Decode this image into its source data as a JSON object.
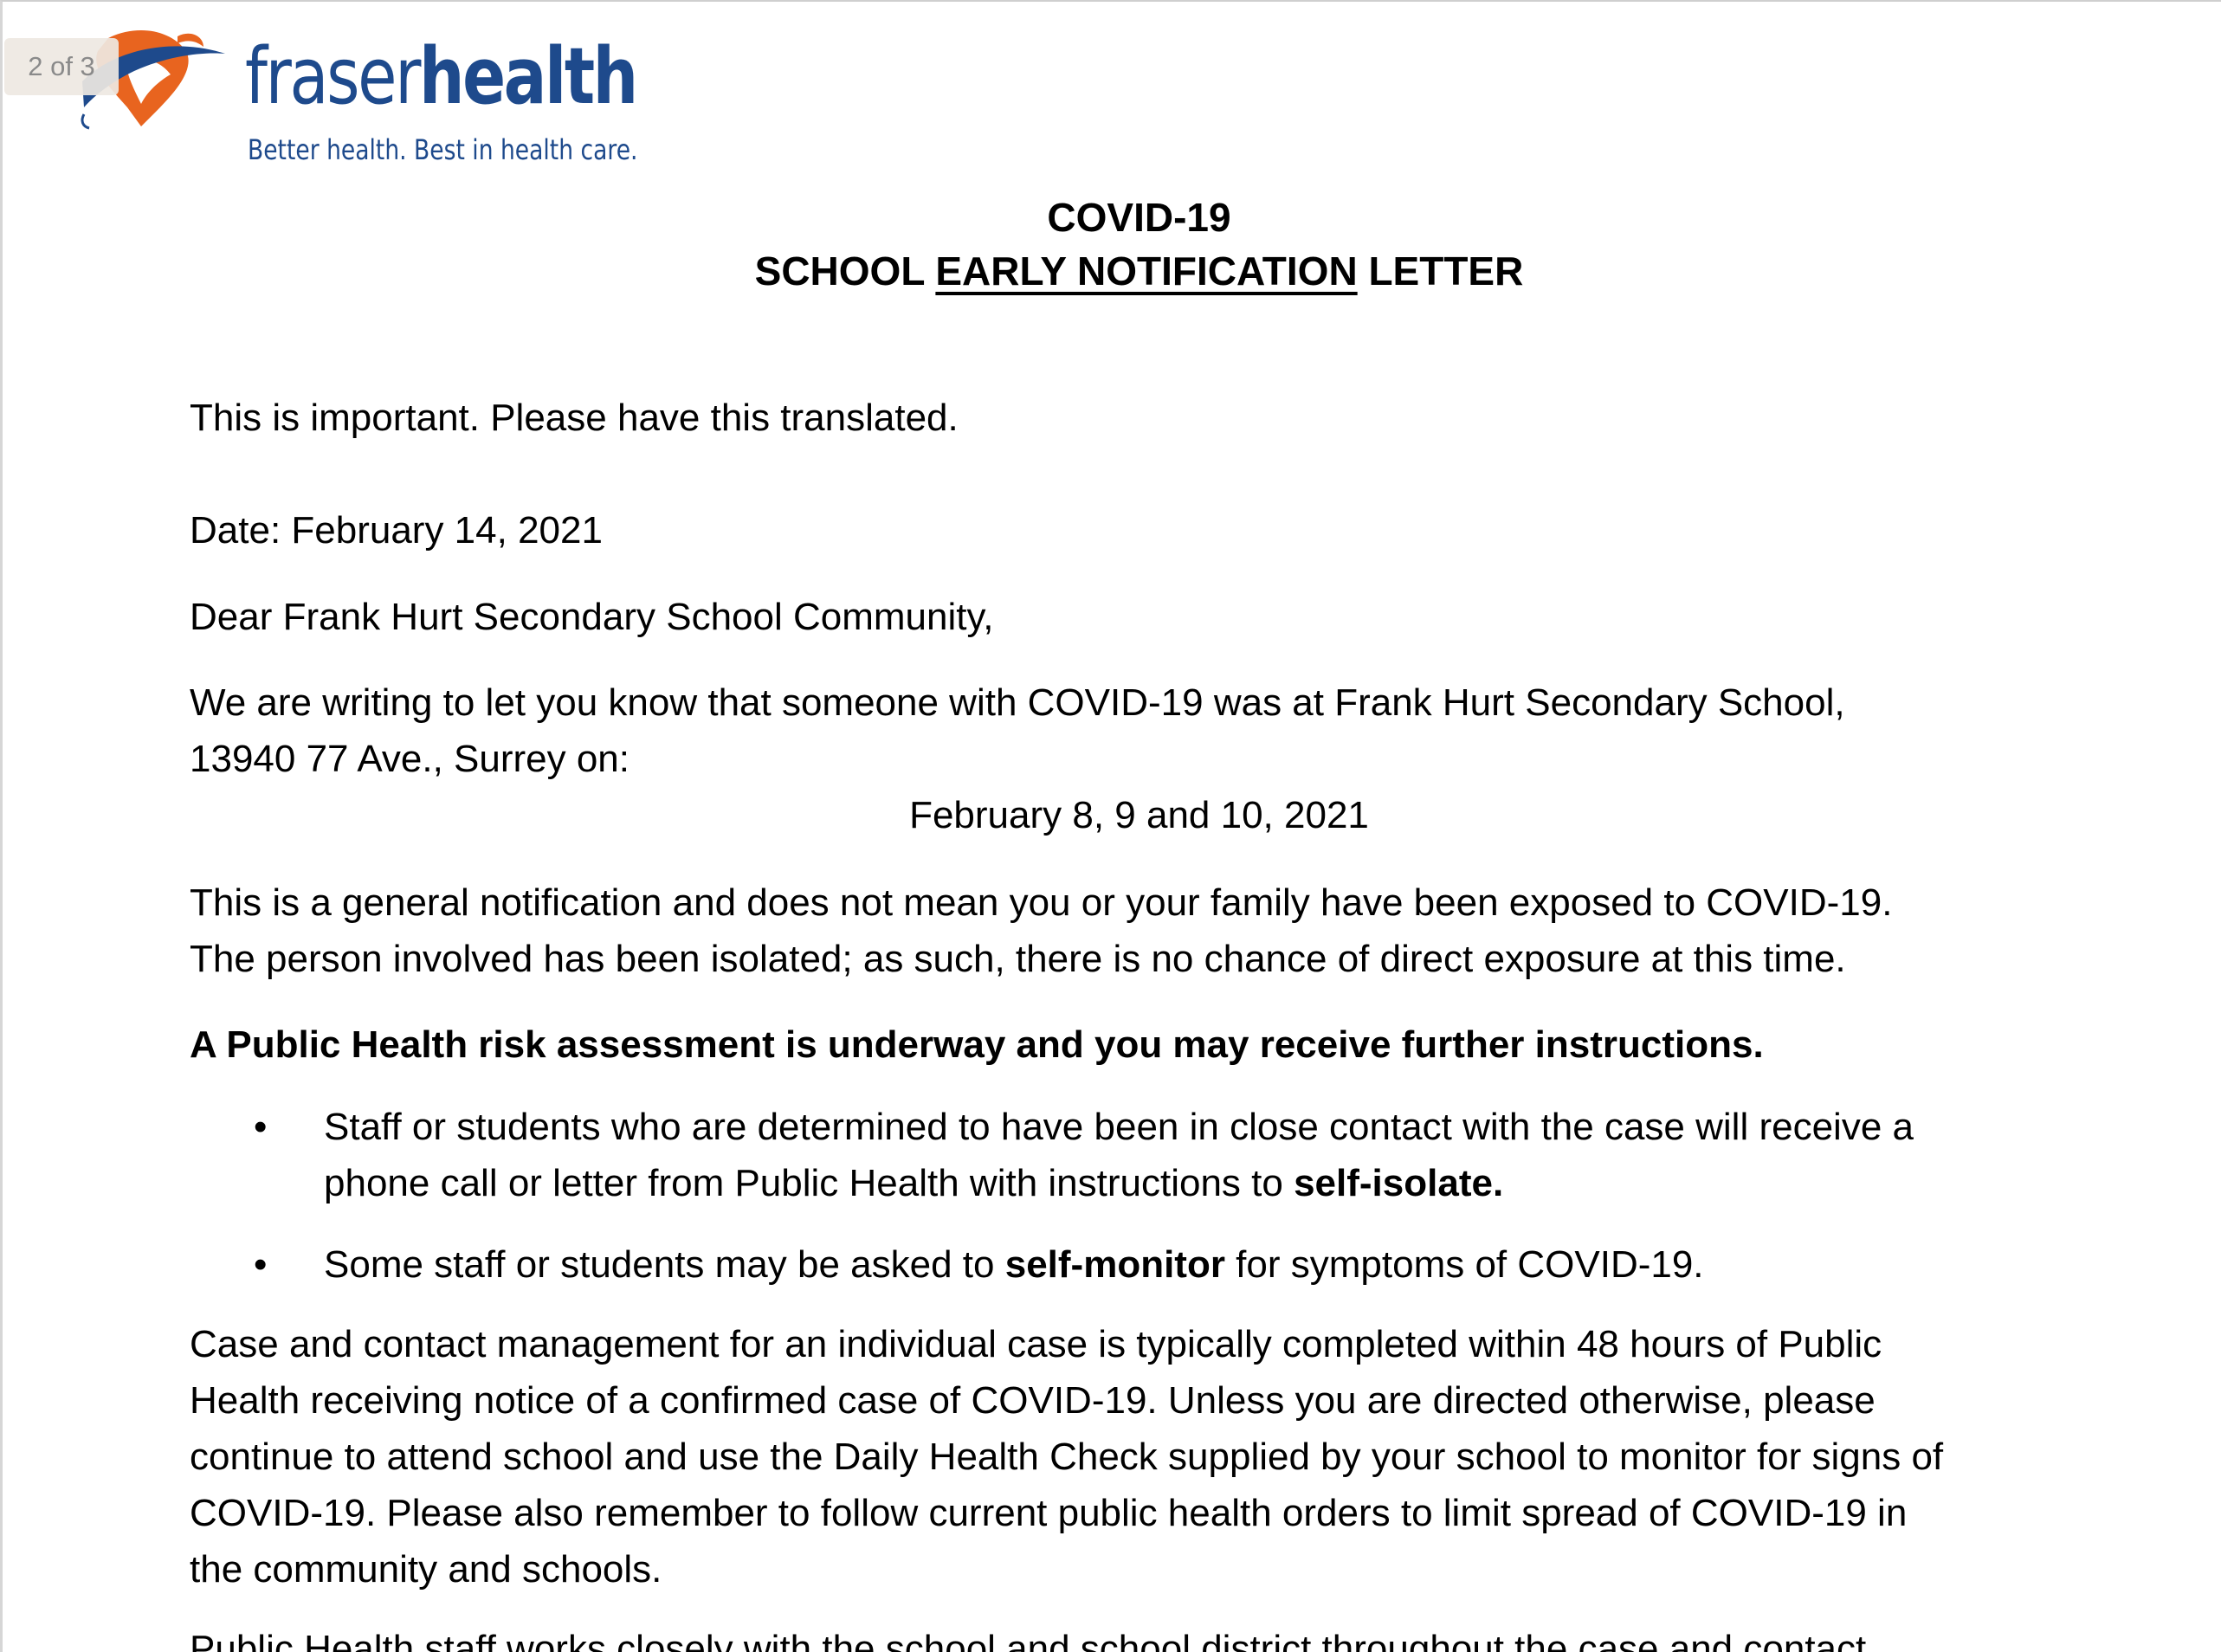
{
  "page_counter": "2 of 3",
  "logo": {
    "word_part1": "fraser",
    "word_part2": "health",
    "tagline": "Better health. Best in health care.",
    "colors": {
      "orange": "#e8641f",
      "blue": "#1e4a8c"
    }
  },
  "heading": {
    "line1": "COVID-19",
    "line2_pre": "SCHOOL ",
    "line2_underlined": "EARLY NOTIFICATION",
    "line2_post": " LETTER"
  },
  "important_note": "This is important. Please have this translated.",
  "date_line": "Date: February 14, 2021",
  "salutation": "Dear Frank Hurt Secondary School Community,",
  "para1": {
    "line1": "We are writing to let you know that someone with COVID-19 was at Frank Hurt Secondary School,",
    "line2": "13940 77 Ave., Surrey on:"
  },
  "exposure_dates": "February 8, 9 and 10, 2021",
  "para2": {
    "line1": "This is a general notification and does not mean you or your family have been exposed to COVID-19.",
    "line2": "The person involved has been isolated; as such, there is no chance of direct exposure at this time."
  },
  "risk_statement": "A Public Health risk assessment is underway and you may receive further instructions.",
  "bullets": [
    {
      "line1": "Staff or students who are determined to have been in close contact with the case will receive a",
      "line2_pre": "phone call or letter from Public Health with instructions to ",
      "line2_bold": "self-isolate."
    },
    {
      "pre": "Some staff or students may be asked to ",
      "bold": "self-monitor",
      "post": " for symptoms of COVID-19."
    }
  ],
  "bullet_symbol": "•",
  "para3": {
    "line1": "Case and contact management for an individual case is typically completed within 48 hours of Public",
    "line2": "Health receiving notice of a confirmed case of COVID-19. Unless you are directed otherwise, please",
    "line3": "continue to attend school and use the Daily Health Check supplied by your school to monitor for signs of",
    "line4": "COVID-19. Please also remember to follow current public health orders to limit spread of COVID-19 in",
    "line5": "the community and schools."
  },
  "para4_partial": "Public Health staff works closely with the school and school district throughout the case and contact"
}
